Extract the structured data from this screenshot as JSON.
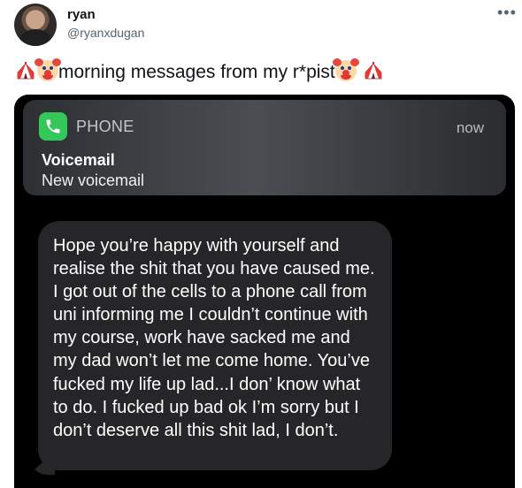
{
  "tweet": {
    "author_name": "ryan",
    "author_handle": "@ryanxdugan",
    "more_icon": "more-horizontal-icon",
    "text_main": "morning messages from my r*pist",
    "emojis": [
      "circus-tent",
      "clown-face",
      "clown-face",
      "circus-tent"
    ]
  },
  "notification": {
    "app_icon": "phone-icon",
    "app_name": "PHONE",
    "time": "now",
    "title": "Voicemail",
    "body": "New voicemail"
  },
  "message": {
    "text": "Hope you’re happy with yourself and realise the shit that you have caused me. I got out of the cells to a phone call from uni informing me I couldn’t continue with my course, work have sacked me and my dad won’t let me come home. You’ve fucked my life up lad...I don’ know what to do. I fucked up bad ok I’m sorry but I don’t deserve all this shit lad, I don’t."
  },
  "colors": {
    "handle": "#536471",
    "phone_green": "#34c759",
    "bubble": "#262628"
  }
}
